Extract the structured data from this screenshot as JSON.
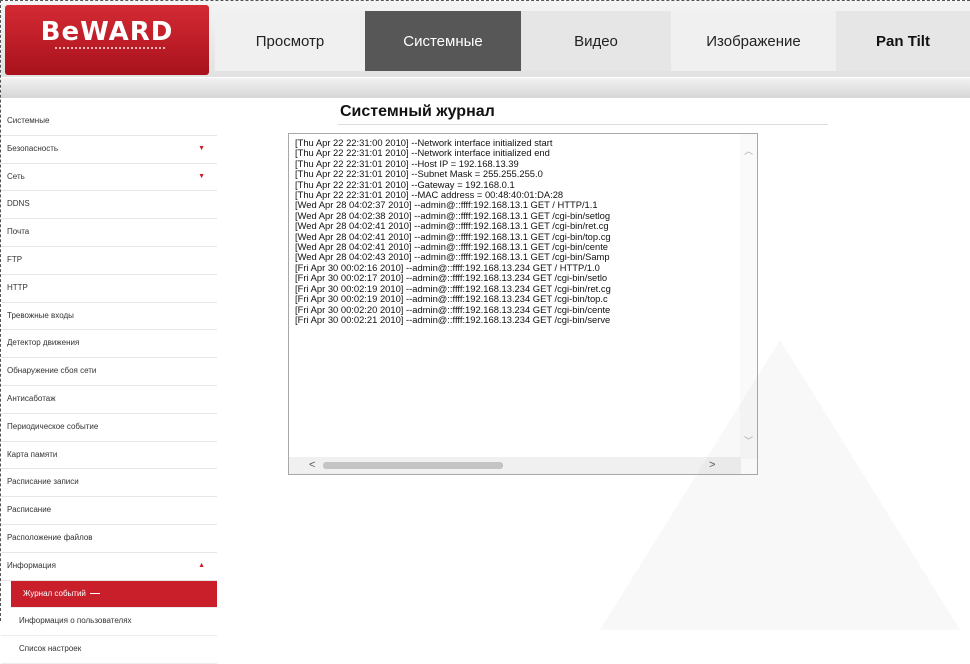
{
  "brand": {
    "logo": "BeWARD"
  },
  "tabs": [
    {
      "label": "Просмотр",
      "active": false
    },
    {
      "label": "Системные",
      "active": true
    },
    {
      "label": "Видео",
      "active": false
    },
    {
      "label": "Изображение",
      "active": false
    },
    {
      "label": "Pan Tilt",
      "active": false
    }
  ],
  "sidebar": {
    "items": [
      {
        "label": "Системные",
        "arrow": ""
      },
      {
        "label": "Безопасность",
        "arrow": "▼"
      },
      {
        "label": "Сеть",
        "arrow": "▼"
      },
      {
        "label": "DDNS",
        "arrow": ""
      },
      {
        "label": "Почта",
        "arrow": ""
      },
      {
        "label": "FTP",
        "arrow": ""
      },
      {
        "label": "HTTP",
        "arrow": ""
      },
      {
        "label": "Тревожные входы",
        "arrow": ""
      },
      {
        "label": "Детектор движения",
        "arrow": ""
      },
      {
        "label": "Обнаружение сбоя сети",
        "arrow": ""
      },
      {
        "label": "Антисаботаж",
        "arrow": ""
      },
      {
        "label": "Периодическое событие",
        "arrow": ""
      },
      {
        "label": "Карта памяти",
        "arrow": ""
      },
      {
        "label": "Расписание записи",
        "arrow": ""
      },
      {
        "label": "Расписание",
        "arrow": ""
      },
      {
        "label": "Расположение файлов",
        "arrow": ""
      },
      {
        "label": "Информация",
        "arrow": "▲"
      }
    ],
    "sub_items": [
      {
        "label": "Журнал событий",
        "active": true
      },
      {
        "label": "Информация о пользователях",
        "active": false
      },
      {
        "label": "Список настроек",
        "active": false
      }
    ]
  },
  "main": {
    "title": "Системный журнал",
    "log": [
      "[Thu Apr 22 22:31:00 2010] --Network interface initialized start",
      "[Thu Apr 22 22:31:01 2010] --Network interface initialized end",
      "[Thu Apr 22 22:31:01 2010] --Host IP = 192.168.13.39",
      "[Thu Apr 22 22:31:01 2010] --Subnet Mask = 255.255.255.0",
      "[Thu Apr 22 22:31:01 2010] --Gateway = 192.168.0.1",
      "[Thu Apr 22 22:31:01 2010] --MAC address = 00:48:40:01:DA:28",
      "[Wed Apr 28 04:02:37 2010] --admin@::ffff:192.168.13.1 GET / HTTP/1.1",
      "[Wed Apr 28 04:02:38 2010] --admin@::ffff:192.168.13.1 GET /cgi-bin/setlog",
      "[Wed Apr 28 04:02:41 2010] --admin@::ffff:192.168.13.1 GET /cgi-bin/ret.cg",
      "[Wed Apr 28 04:02:41 2010] --admin@::ffff:192.168.13.1 GET /cgi-bin/top.cg",
      "[Wed Apr 28 04:02:41 2010] --admin@::ffff:192.168.13.1 GET /cgi-bin/cente",
      "[Wed Apr 28 04:02:43 2010] --admin@::ffff:192.168.13.1 GET /cgi-bin/Samp",
      "[Fri Apr 30 00:02:16 2010] --admin@::ffff:192.168.13.234 GET / HTTP/1.0",
      "[Fri Apr 30 00:02:17 2010] --admin@::ffff:192.168.13.234 GET /cgi-bin/setlo",
      "[Fri Apr 30 00:02:19 2010] --admin@::ffff:192.168.13.234 GET /cgi-bin/ret.cg",
      "[Fri Apr 30 00:02:19 2010] --admin@::ffff:192.168.13.234 GET /cgi-bin/top.c",
      "[Fri Apr 30 00:02:20 2010] --admin@::ffff:192.168.13.234 GET /cgi-bin/cente",
      "[Fri Apr 30 00:02:21 2010] --admin@::ffff:192.168.13.234 GET /cgi-bin/serve"
    ]
  },
  "colors": {
    "accent": "#c81f2b",
    "active_tab": "#575757"
  }
}
